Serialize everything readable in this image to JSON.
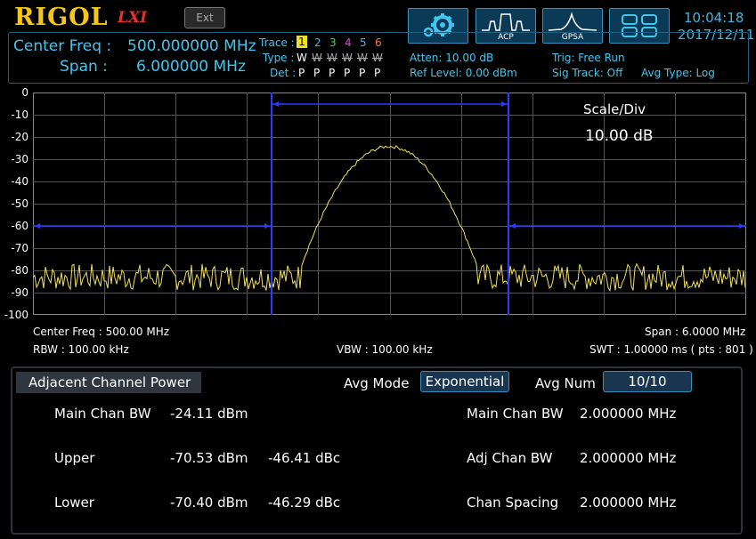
{
  "brand": {
    "logo": "RIGOL",
    "sub": "LXI"
  },
  "header": {
    "ext_label": "Ext",
    "buttons": [
      {
        "name": "settings",
        "caption": ""
      },
      {
        "name": "acp",
        "caption": "ACP"
      },
      {
        "name": "gpsa",
        "caption": "GPSA"
      },
      {
        "name": "layout",
        "caption": ""
      }
    ],
    "time": "10:04:18",
    "date": "2017/12/11"
  },
  "status": {
    "center_label": "Center Freq :",
    "center_value": "500.000000 MHz",
    "span_label": "Span :",
    "span_value": "6.000000 MHz",
    "trace_label": "Trace :",
    "trace_numbers": [
      "1",
      "2",
      "3",
      "4",
      "5",
      "6"
    ],
    "type_label": "Type :",
    "type_values": [
      "W",
      "W",
      "W",
      "W",
      "W",
      "W"
    ],
    "det_label": "Det :",
    "det_values": [
      "P",
      "P",
      "P",
      "P",
      "P",
      "P"
    ],
    "atten": "Atten: 10.00 dB",
    "ref_level": "Ref Level: 0.00 dBm",
    "trig": "Trig: Free Run",
    "sig_track": "Sig Track: Off",
    "avg_type": "Avg Type: Log"
  },
  "plot": {
    "y_labels": [
      "0",
      "-10",
      "-20",
      "-30",
      "-40",
      "-50",
      "-60",
      "-70",
      "-80",
      "-90",
      "-100"
    ],
    "scale_label": "Scale/Div",
    "scale_value": "10.00 dB",
    "center_freq": "Center Freq : 500.00 MHz",
    "span": "Span : 6.0000 MHz",
    "rbw": "RBW : 100.00 kHz",
    "vbw": "VBW : 100.00 kHz",
    "swt": "SWT : 1.00000 ms ( pts : 801 )",
    "trace_color": "#f0e060"
  },
  "acp": {
    "title": "Adjacent Channel Power",
    "avg_mode_label": "Avg Mode",
    "avg_mode_value": "Exponential",
    "avg_num_label": "Avg Num",
    "avg_num_value": "10/10",
    "rows": [
      {
        "label": "Main Chan BW",
        "dbm": "-24.11 dBm",
        "dbc": "",
        "param": "Main Chan BW",
        "param_value": "2.000000 MHz"
      },
      {
        "label": "Upper",
        "dbm": "-70.53 dBm",
        "dbc": "-46.41 dBc",
        "param": "Adj Chan BW",
        "param_value": "2.000000 MHz"
      },
      {
        "label": "Lower",
        "dbm": "-70.40 dBm",
        "dbc": "-46.29 dBc",
        "param": "Chan Spacing",
        "param_value": "2.000000 MHz"
      }
    ]
  }
}
